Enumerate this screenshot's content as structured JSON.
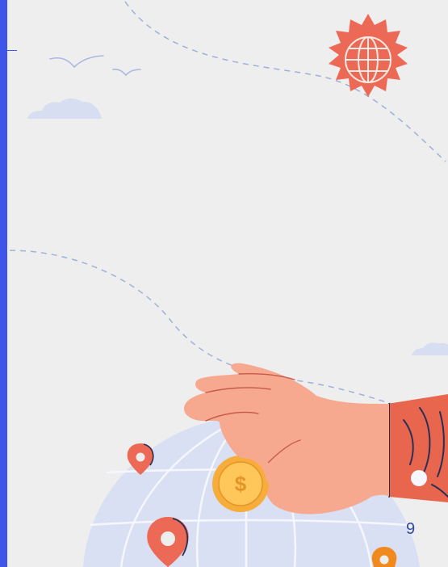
{
  "page": {
    "number": "9"
  },
  "illustration": {
    "icons": [
      "globe-badge-icon",
      "dollar-coin-icon",
      "location-pin-icon",
      "bird-icon",
      "cloud-icon"
    ],
    "coin_symbol": "$"
  },
  "colors": {
    "accent_bar": "#3d55e8",
    "background": "#eeeeee",
    "badge": "#ec6a55",
    "globe": "#d9e0f4",
    "coin": "#f6ad3a",
    "skin": "#f7a98f",
    "sleeve": "#e8664e",
    "dashes": "#9fb0d8",
    "page_number": "#2d4aa6"
  }
}
